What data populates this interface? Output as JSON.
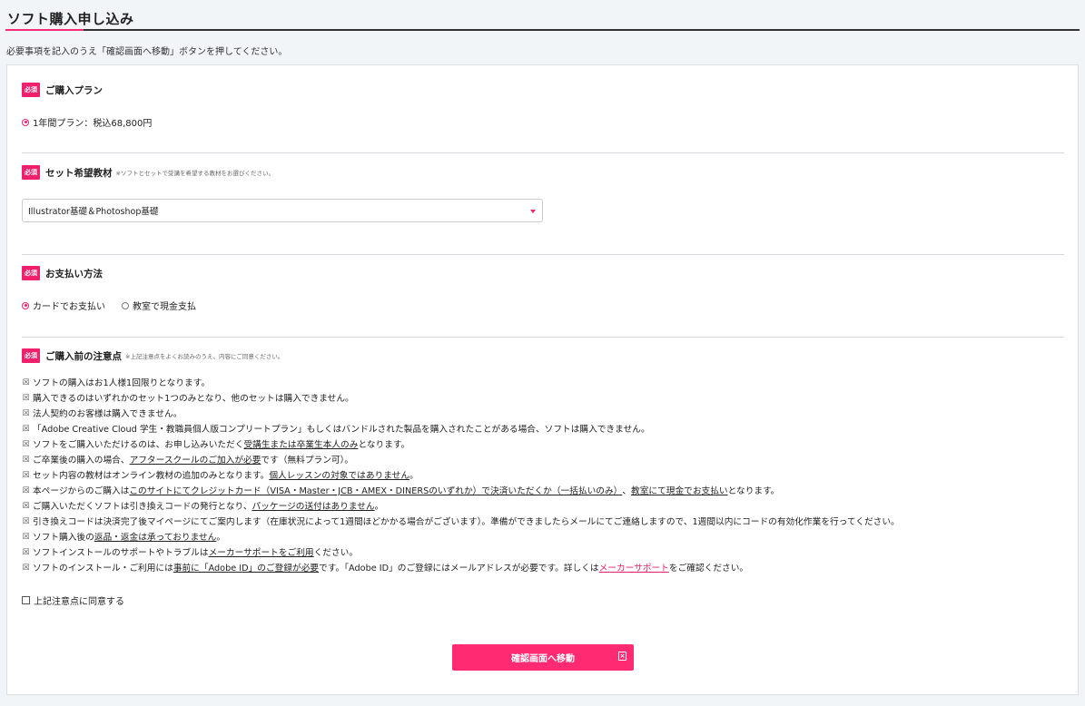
{
  "page": {
    "title": "ソフト購入申し込み",
    "intro": "必要事項を記入のうえ「確認画面へ移動」ボタンを押してください。"
  },
  "badge": "必須",
  "plan": {
    "title": "ご購入プラン",
    "options": [
      {
        "label": "1年間プラン：税込68,800円",
        "selected": true
      }
    ]
  },
  "material": {
    "title": "セット希望教材",
    "note": "※ソフトとセットで受講を希望する教材をお選びください。",
    "selected": "Illustrator基礎＆Photoshop基礎"
  },
  "payment": {
    "title": "お支払い方法",
    "options": [
      {
        "label": "カードでお支払い",
        "selected": true
      },
      {
        "label": "教室で現金支払",
        "selected": false
      }
    ]
  },
  "notice": {
    "title": "ご購入前の注意点",
    "note": "※上記注意点をよくお読みのうえ、内容にご同意ください。",
    "items": [
      [
        {
          "t": "ソフトの購入はお1人様1回限りとなります。"
        }
      ],
      [
        {
          "t": "購入できるのはいずれかのセット1つのみとなり、他のセットは購入できません。"
        }
      ],
      [
        {
          "t": "法人契約のお客様は購入できません。"
        }
      ],
      [
        {
          "t": "「Adobe Creative Cloud 学生・教職員個人版コンプリートプラン」もしくはバンドルされた製品を購入されたことがある場合、ソフトは購入できません。"
        }
      ],
      [
        {
          "t": "ソフトをご購入いただけるのは、お申し込みいただく"
        },
        {
          "t": "受講生または卒業生本人のみ",
          "u": true
        },
        {
          "t": "となります。"
        }
      ],
      [
        {
          "t": "ご卒業後の購入の場合、"
        },
        {
          "t": "アフタースクールのご加入が必要",
          "u": true
        },
        {
          "t": "です（無料プラン可）。"
        }
      ],
      [
        {
          "t": "セット内容の教材はオンライン教材の追加のみとなります。"
        },
        {
          "t": "個人レッスンの対象ではありません",
          "u": true
        },
        {
          "t": "。"
        }
      ],
      [
        {
          "t": "本ページからのご購入は"
        },
        {
          "t": "このサイトにてクレジットカード（VISA・Master・JCB・AMEX・DINERSのいずれか）で決済いただくか（一括払いのみ）",
          "u": true
        },
        {
          "t": "、"
        },
        {
          "t": "教室にて現金でお支払い",
          "u": true
        },
        {
          "t": "となります。"
        }
      ],
      [
        {
          "t": "ご購入いただくソフトは引き換えコードの発行となり、"
        },
        {
          "t": "パッケージの送付はありません",
          "u": true
        },
        {
          "t": "。"
        }
      ],
      [
        {
          "t": "引き換えコードは決済完了後マイページにてご案内します（在庫状況によって1週間ほどかかる場合がございます）。準備ができましたらメールにてご連絡しますので、1週間以内にコードの有効化作業を行ってください。"
        }
      ],
      [
        {
          "t": "ソフト購入後の"
        },
        {
          "t": "返品・返金は承っておりません",
          "u": true
        },
        {
          "t": "。"
        }
      ],
      [
        {
          "t": "ソフトインストールのサポートやトラブルは"
        },
        {
          "t": "メーカーサポートをご利用",
          "u": true
        },
        {
          "t": "ください。"
        }
      ],
      [
        {
          "t": "ソフトのインストール・ご利用には"
        },
        {
          "t": "事前に「Adobe ID」のご登録が必要",
          "u": true
        },
        {
          "t": "です。「Adobe ID」のご登録にはメールアドレスが必要です。詳しくは"
        },
        {
          "t": "メーカーサポート",
          "link": true
        },
        {
          "t": "をご確認ください。"
        }
      ]
    ]
  },
  "agree": {
    "label": "上記注意点に同意する",
    "checked": false
  },
  "submit": {
    "label": "確認画面へ移動"
  },
  "colors": {
    "accent": "#f0206c",
    "button": "#ff2a72"
  }
}
